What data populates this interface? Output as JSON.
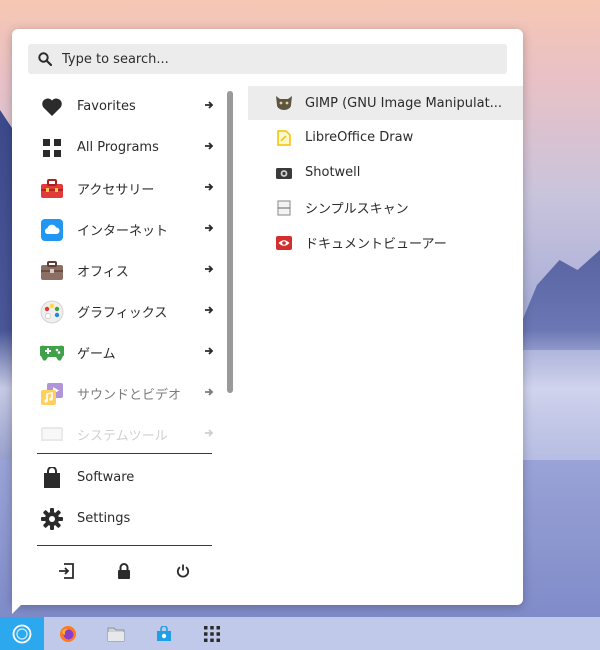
{
  "search": {
    "placeholder": "Type to search..."
  },
  "categories": [
    {
      "label": "Favorites",
      "icon": "heart-icon"
    },
    {
      "label": "All Programs",
      "icon": "grid-icon"
    },
    {
      "label": "アクセサリー",
      "icon": "toolbox-icon"
    },
    {
      "label": "インターネット",
      "icon": "cloud-icon"
    },
    {
      "label": "オフィス",
      "icon": "briefcase-icon"
    },
    {
      "label": "グラフィックス",
      "icon": "palette-icon"
    },
    {
      "label": "ゲーム",
      "icon": "gamepad-icon"
    },
    {
      "label": "サウンドとビデオ",
      "icon": "music-video-icon"
    },
    {
      "label": "システムツール",
      "icon": "system-tools-icon"
    }
  ],
  "system_items": [
    {
      "label": "Software",
      "icon": "shopping-bag-icon"
    },
    {
      "label": "Settings",
      "icon": "gear-icon"
    }
  ],
  "session_buttons": [
    "logout-icon",
    "lock-icon",
    "power-icon"
  ],
  "apps": [
    {
      "label": "GIMP (GNU Image Manipulat...",
      "icon": "gimp-icon",
      "selected": true
    },
    {
      "label": "LibreOffice Draw",
      "icon": "libreoffice-draw-icon"
    },
    {
      "label": "Shotwell",
      "icon": "shotwell-icon"
    },
    {
      "label": "シンプルスキャン",
      "icon": "scanner-icon"
    },
    {
      "label": "ドキュメントビューアー",
      "icon": "document-viewer-icon"
    }
  ],
  "taskbar": [
    "zorin-menu-icon",
    "firefox-icon",
    "files-icon",
    "software-store-icon",
    "app-grid-icon"
  ],
  "colors": {
    "accent": "#2ca9ee",
    "selected_bg": "#ececec",
    "search_bg": "#ececec"
  }
}
